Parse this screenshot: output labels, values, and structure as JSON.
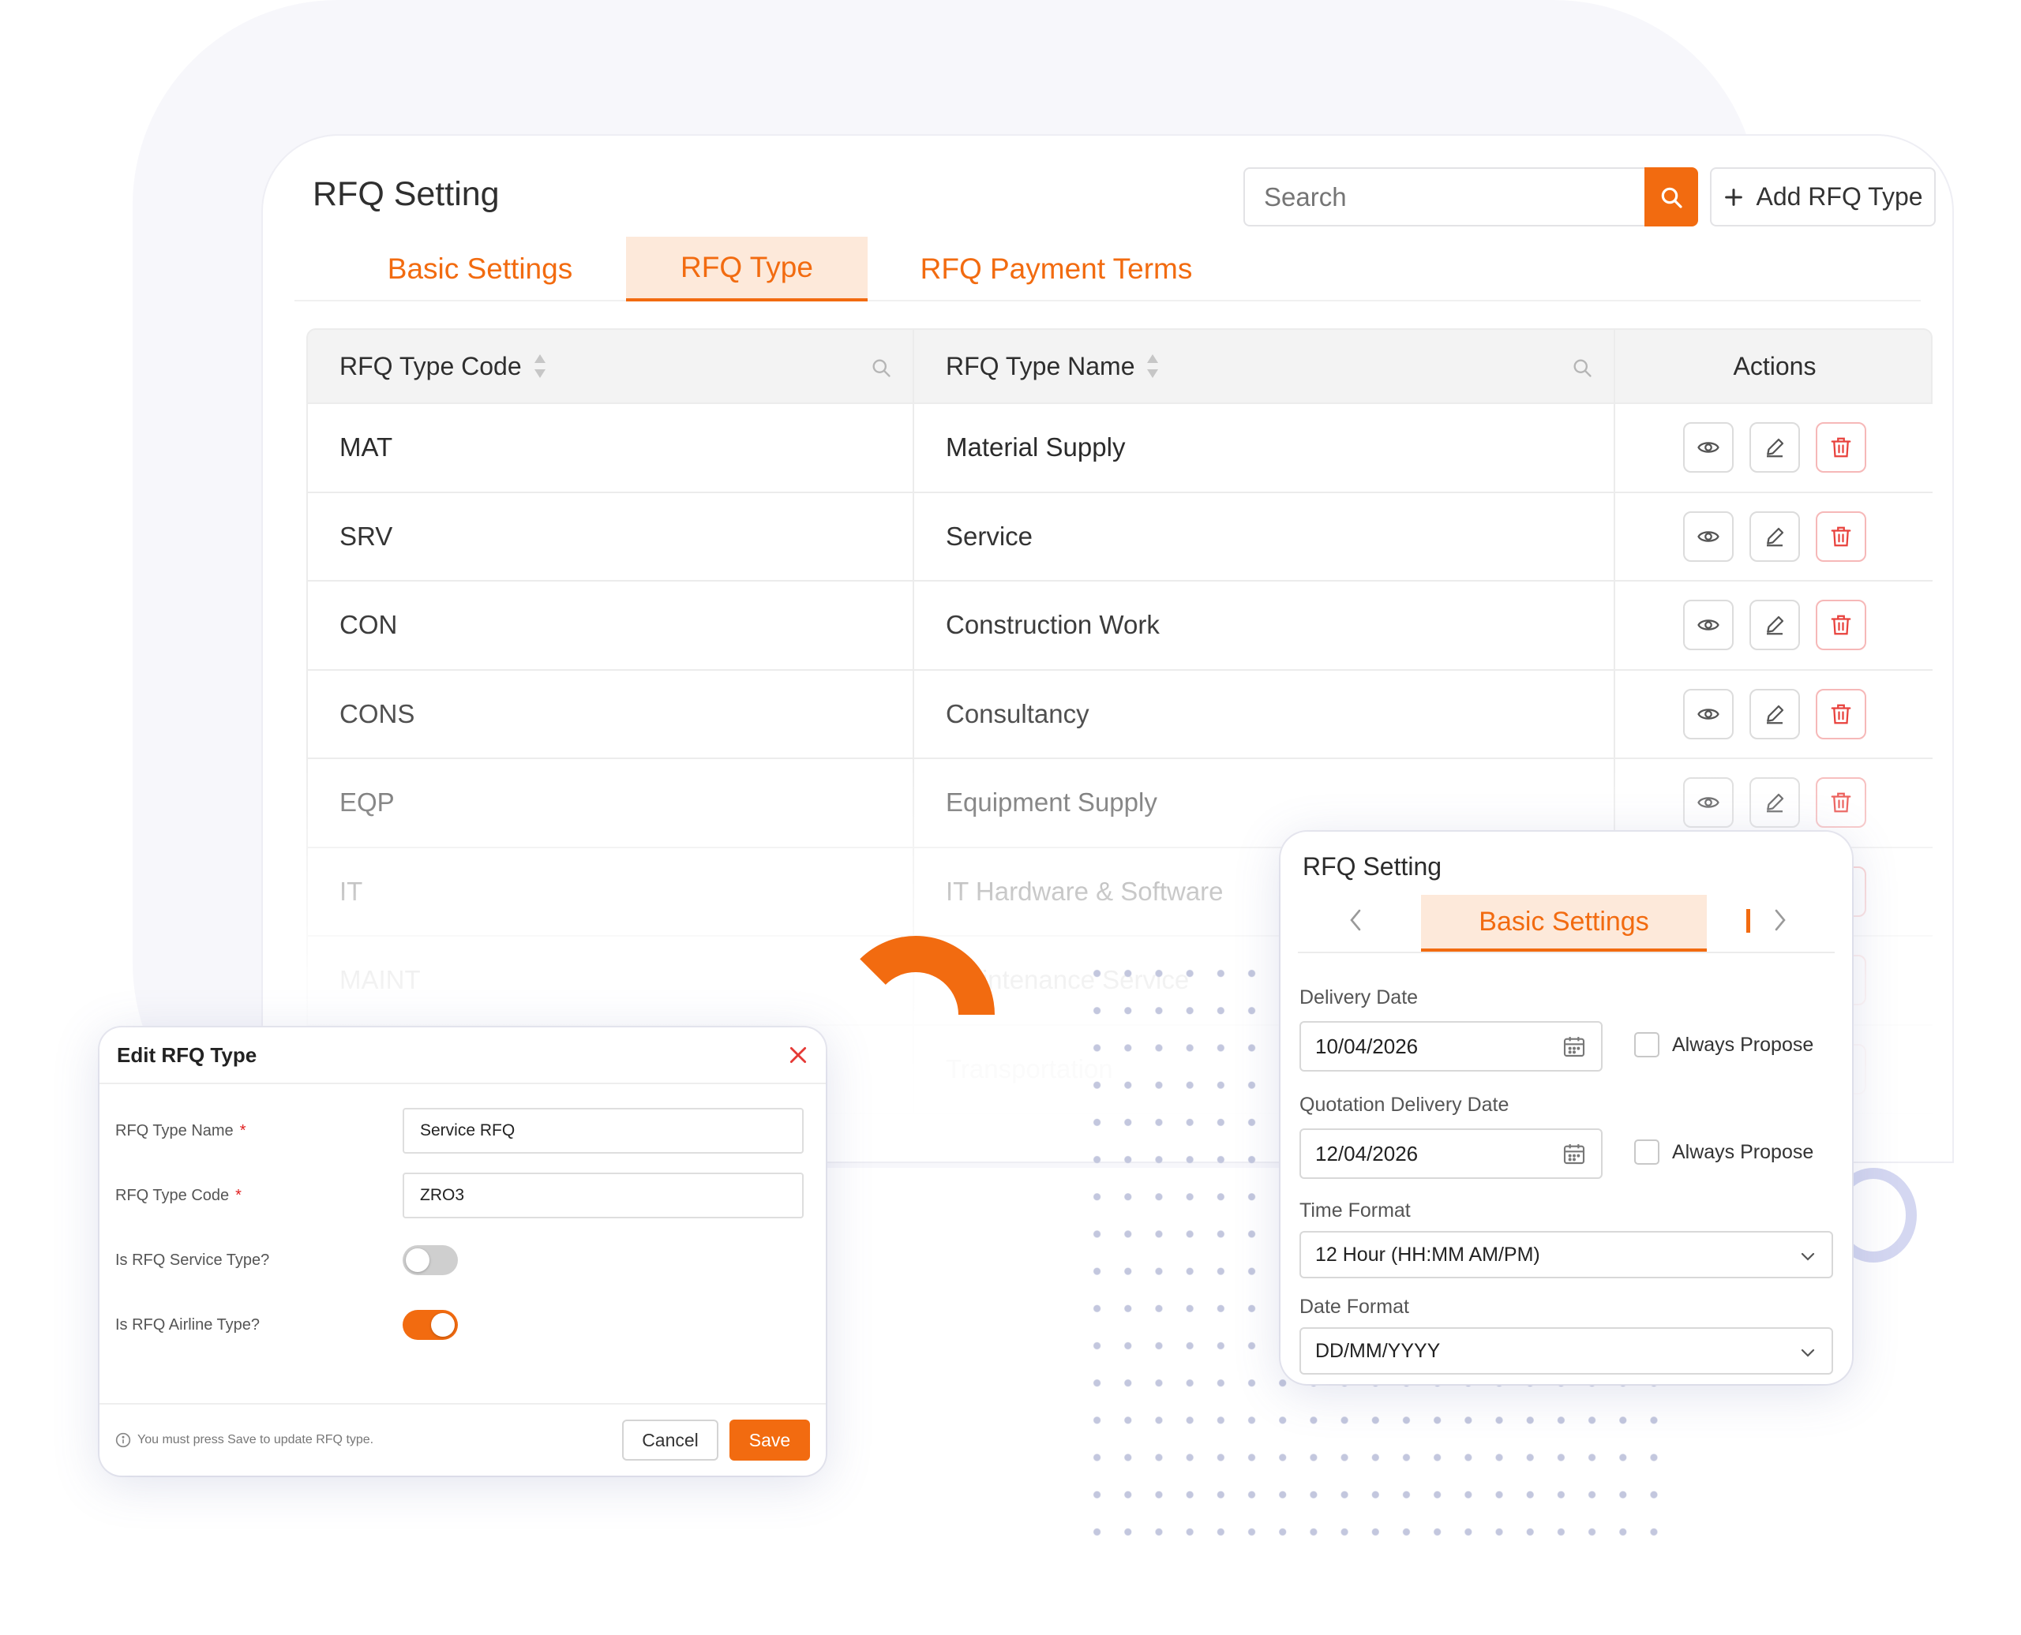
{
  "main": {
    "title": "RFQ Setting",
    "search_placeholder": "Search",
    "add_button_label": "Add RFQ Type",
    "tabs": [
      {
        "label": "Basic Settings",
        "active": false
      },
      {
        "label": "RFQ Type",
        "active": true
      },
      {
        "label": "RFQ Payment Terms",
        "active": false
      }
    ],
    "table": {
      "columns": [
        "RFQ Type Code",
        "RFQ Type Name",
        "Actions"
      ],
      "rows": [
        {
          "code": "MAT",
          "name": "Material Supply"
        },
        {
          "code": "SRV",
          "name": "Service"
        },
        {
          "code": "CON",
          "name": "Construction Work"
        },
        {
          "code": "CONS",
          "name": "Consultancy"
        },
        {
          "code": "EQP",
          "name": "Equipment Supply"
        },
        {
          "code": "IT",
          "name": "IT Hardware & Software"
        },
        {
          "code": "MAINT",
          "name": "Maintenance Service"
        },
        {
          "code": "",
          "name": "Transportation"
        }
      ],
      "row_actions": [
        "eye-icon",
        "pencil-icon",
        "trash-icon"
      ]
    }
  },
  "edit_modal": {
    "title": "Edit RFQ Type",
    "fields": {
      "type_name_label": "RFQ Type Name",
      "type_name_value": "Service RFQ",
      "type_code_label": "RFQ Type Code",
      "type_code_value": "ZRO3",
      "service_type_label": "Is RFQ Service Type?",
      "service_type_on": false,
      "airline_type_label": "Is RFQ Airline Type?",
      "airline_type_on": true,
      "required_mark": "*"
    },
    "footer_note": "You must press Save to update RFQ type.",
    "cancel_label": "Cancel",
    "save_label": "Save"
  },
  "settings_panel": {
    "title": "RFQ Setting",
    "active_tab": "Basic Settings",
    "delivery_date_label": "Delivery Date",
    "delivery_date_value": "10/04/2026",
    "quotation_date_label": "Quotation Delivery Date",
    "quotation_date_value": "12/04/2026",
    "always_propose_label": "Always Propose",
    "time_format_label": "Time Format",
    "time_format_value": "12 Hour (HH:MM AM/PM)",
    "date_format_label": "Date Format",
    "date_format_value": "DD/MM/YYYY"
  },
  "colors": {
    "accent": "#f26b10",
    "accent_light": "#fde9da",
    "danger": "#e8413c"
  }
}
